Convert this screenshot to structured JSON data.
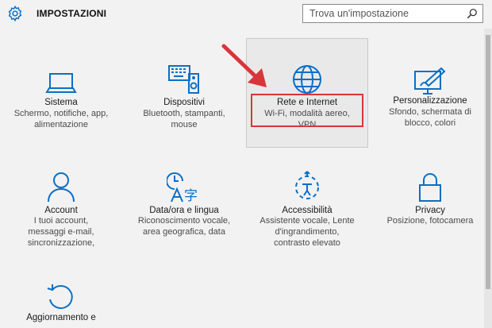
{
  "header": {
    "title": "IMPOSTAZIONI",
    "search_placeholder": "Trova un'impostazione"
  },
  "accent_color": "#0a6fc6",
  "highlight_color": "#d9353a",
  "tiles": [
    {
      "icon": "laptop-icon",
      "label": "Sistema",
      "desc1": "Schermo, notifiche, app,",
      "desc2": "alimentazione",
      "desc3": ""
    },
    {
      "icon": "devices-icon",
      "label": "Dispositivi",
      "desc1": "Bluetooth, stampanti,",
      "desc2": "mouse",
      "desc3": ""
    },
    {
      "icon": "globe-icon",
      "label": "Rete e Internet",
      "desc1": "Wi-Fi, modalità aereo,",
      "desc2": "VPN",
      "desc3": ""
    },
    {
      "icon": "personalization-icon",
      "label": "Personalizzazione",
      "desc1": "Sfondo, schermata di",
      "desc2": "blocco, colori",
      "desc3": ""
    },
    {
      "icon": "account-icon",
      "label": "Account",
      "desc1": "I tuoi account,",
      "desc2": "messaggi e-mail,",
      "desc3": "sincronizzazione,"
    },
    {
      "icon": "time-language-icon",
      "label": "Data/ora e lingua",
      "desc1": "Riconoscimento vocale,",
      "desc2": "area geografica, data",
      "desc3": ""
    },
    {
      "icon": "accessibility-icon",
      "label": "Accessibilità",
      "desc1": "Assistente vocale, Lente",
      "desc2": "d'ingrandimento,",
      "desc3": "contrasto elevato"
    },
    {
      "icon": "lock-icon",
      "label": "Privacy",
      "desc1": "Posizione, fotocamera",
      "desc2": "",
      "desc3": ""
    },
    {
      "icon": "update-icon",
      "label": "Aggiornamento e",
      "desc1": "",
      "desc2": "",
      "desc3": ""
    }
  ]
}
